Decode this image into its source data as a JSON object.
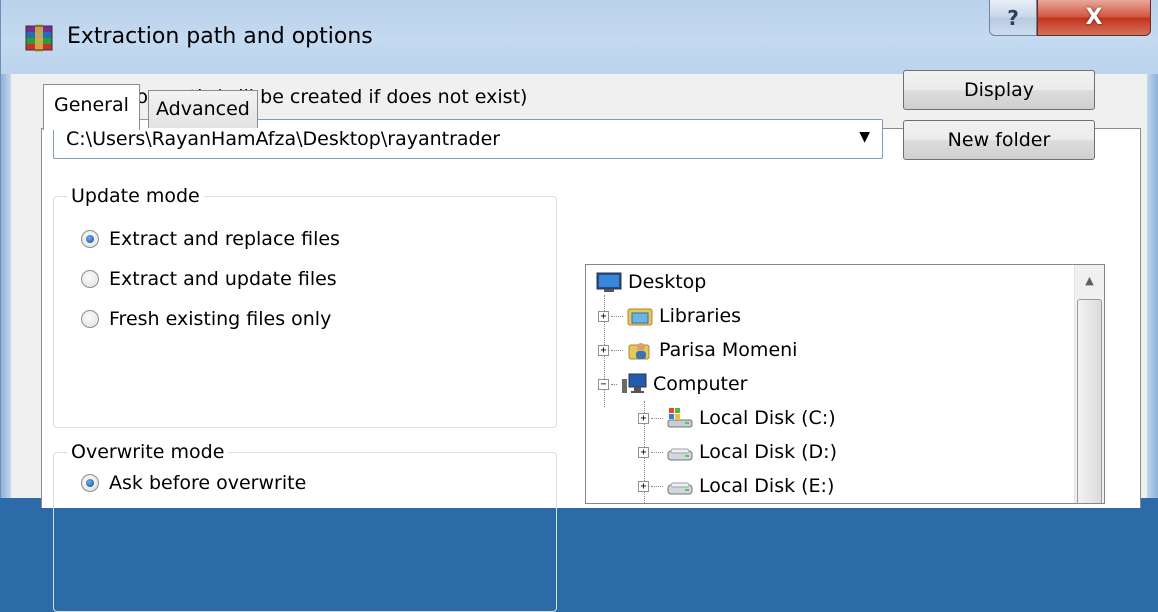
{
  "window": {
    "title": "Extraction path and options",
    "help_label": "?",
    "close_label": "X"
  },
  "tabs": [
    {
      "label": "General",
      "active": true
    },
    {
      "label": "Advanced",
      "active": false
    }
  ],
  "destination": {
    "label": "Destination path (will be created if does not exist)",
    "value": "C:\\Users\\RayanHamAfza\\Desktop\\rayantrader",
    "arrow": "▼"
  },
  "buttons": {
    "display": "Display",
    "new_folder": "New folder"
  },
  "update_mode": {
    "legend": "Update mode",
    "options": [
      {
        "label": "Extract and replace files",
        "checked": true
      },
      {
        "label": "Extract and update files",
        "checked": false
      },
      {
        "label": "Fresh existing files only",
        "checked": false
      }
    ]
  },
  "overwrite_mode": {
    "legend": "Overwrite mode",
    "options": [
      {
        "label": "Ask before overwrite",
        "checked": true
      }
    ]
  },
  "tree": {
    "scroll_up": "▲",
    "items": [
      {
        "label": "Desktop",
        "icon": "desktop-icon",
        "expander": ""
      },
      {
        "label": "Libraries",
        "icon": "libraries-icon",
        "expander": "+"
      },
      {
        "label": "Parisa Momeni",
        "icon": "user-folder-icon",
        "expander": "+"
      },
      {
        "label": "Computer",
        "icon": "computer-icon",
        "expander": "−"
      },
      {
        "label": "Local Disk (C:)",
        "icon": "system-drive-icon",
        "expander": "+"
      },
      {
        "label": "Local Disk (D:)",
        "icon": "drive-icon",
        "expander": "+"
      },
      {
        "label": "Local Disk (E:)",
        "icon": "drive-icon",
        "expander": "+"
      }
    ]
  },
  "colors": {
    "accent": "#2c6aa8",
    "close_red": "#c0341c",
    "radio_dot": "#14498d"
  }
}
